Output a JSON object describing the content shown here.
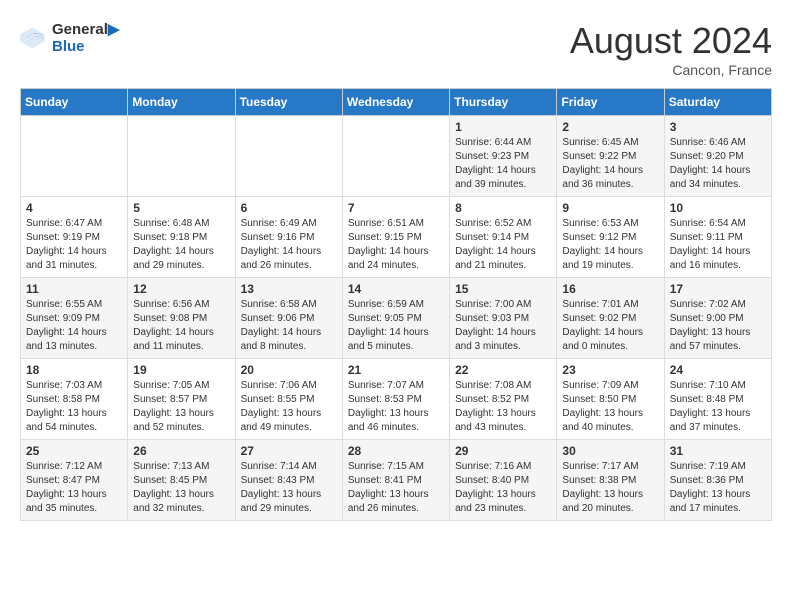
{
  "logo": {
    "line1": "General",
    "line2": "Blue"
  },
  "title": "August 2024",
  "location": "Cancon, France",
  "days_of_week": [
    "Sunday",
    "Monday",
    "Tuesday",
    "Wednesday",
    "Thursday",
    "Friday",
    "Saturday"
  ],
  "weeks": [
    [
      {
        "day": "",
        "info": ""
      },
      {
        "day": "",
        "info": ""
      },
      {
        "day": "",
        "info": ""
      },
      {
        "day": "",
        "info": ""
      },
      {
        "day": "1",
        "info": "Sunrise: 6:44 AM\nSunset: 9:23 PM\nDaylight: 14 hours\nand 39 minutes."
      },
      {
        "day": "2",
        "info": "Sunrise: 6:45 AM\nSunset: 9:22 PM\nDaylight: 14 hours\nand 36 minutes."
      },
      {
        "day": "3",
        "info": "Sunrise: 6:46 AM\nSunset: 9:20 PM\nDaylight: 14 hours\nand 34 minutes."
      }
    ],
    [
      {
        "day": "4",
        "info": "Sunrise: 6:47 AM\nSunset: 9:19 PM\nDaylight: 14 hours\nand 31 minutes."
      },
      {
        "day": "5",
        "info": "Sunrise: 6:48 AM\nSunset: 9:18 PM\nDaylight: 14 hours\nand 29 minutes."
      },
      {
        "day": "6",
        "info": "Sunrise: 6:49 AM\nSunset: 9:16 PM\nDaylight: 14 hours\nand 26 minutes."
      },
      {
        "day": "7",
        "info": "Sunrise: 6:51 AM\nSunset: 9:15 PM\nDaylight: 14 hours\nand 24 minutes."
      },
      {
        "day": "8",
        "info": "Sunrise: 6:52 AM\nSunset: 9:14 PM\nDaylight: 14 hours\nand 21 minutes."
      },
      {
        "day": "9",
        "info": "Sunrise: 6:53 AM\nSunset: 9:12 PM\nDaylight: 14 hours\nand 19 minutes."
      },
      {
        "day": "10",
        "info": "Sunrise: 6:54 AM\nSunset: 9:11 PM\nDaylight: 14 hours\nand 16 minutes."
      }
    ],
    [
      {
        "day": "11",
        "info": "Sunrise: 6:55 AM\nSunset: 9:09 PM\nDaylight: 14 hours\nand 13 minutes."
      },
      {
        "day": "12",
        "info": "Sunrise: 6:56 AM\nSunset: 9:08 PM\nDaylight: 14 hours\nand 11 minutes."
      },
      {
        "day": "13",
        "info": "Sunrise: 6:58 AM\nSunset: 9:06 PM\nDaylight: 14 hours\nand 8 minutes."
      },
      {
        "day": "14",
        "info": "Sunrise: 6:59 AM\nSunset: 9:05 PM\nDaylight: 14 hours\nand 5 minutes."
      },
      {
        "day": "15",
        "info": "Sunrise: 7:00 AM\nSunset: 9:03 PM\nDaylight: 14 hours\nand 3 minutes."
      },
      {
        "day": "16",
        "info": "Sunrise: 7:01 AM\nSunset: 9:02 PM\nDaylight: 14 hours\nand 0 minutes."
      },
      {
        "day": "17",
        "info": "Sunrise: 7:02 AM\nSunset: 9:00 PM\nDaylight: 13 hours\nand 57 minutes."
      }
    ],
    [
      {
        "day": "18",
        "info": "Sunrise: 7:03 AM\nSunset: 8:58 PM\nDaylight: 13 hours\nand 54 minutes."
      },
      {
        "day": "19",
        "info": "Sunrise: 7:05 AM\nSunset: 8:57 PM\nDaylight: 13 hours\nand 52 minutes."
      },
      {
        "day": "20",
        "info": "Sunrise: 7:06 AM\nSunset: 8:55 PM\nDaylight: 13 hours\nand 49 minutes."
      },
      {
        "day": "21",
        "info": "Sunrise: 7:07 AM\nSunset: 8:53 PM\nDaylight: 13 hours\nand 46 minutes."
      },
      {
        "day": "22",
        "info": "Sunrise: 7:08 AM\nSunset: 8:52 PM\nDaylight: 13 hours\nand 43 minutes."
      },
      {
        "day": "23",
        "info": "Sunrise: 7:09 AM\nSunset: 8:50 PM\nDaylight: 13 hours\nand 40 minutes."
      },
      {
        "day": "24",
        "info": "Sunrise: 7:10 AM\nSunset: 8:48 PM\nDaylight: 13 hours\nand 37 minutes."
      }
    ],
    [
      {
        "day": "25",
        "info": "Sunrise: 7:12 AM\nSunset: 8:47 PM\nDaylight: 13 hours\nand 35 minutes."
      },
      {
        "day": "26",
        "info": "Sunrise: 7:13 AM\nSunset: 8:45 PM\nDaylight: 13 hours\nand 32 minutes."
      },
      {
        "day": "27",
        "info": "Sunrise: 7:14 AM\nSunset: 8:43 PM\nDaylight: 13 hours\nand 29 minutes."
      },
      {
        "day": "28",
        "info": "Sunrise: 7:15 AM\nSunset: 8:41 PM\nDaylight: 13 hours\nand 26 minutes."
      },
      {
        "day": "29",
        "info": "Sunrise: 7:16 AM\nSunset: 8:40 PM\nDaylight: 13 hours\nand 23 minutes."
      },
      {
        "day": "30",
        "info": "Sunrise: 7:17 AM\nSunset: 8:38 PM\nDaylight: 13 hours\nand 20 minutes."
      },
      {
        "day": "31",
        "info": "Sunrise: 7:19 AM\nSunset: 8:36 PM\nDaylight: 13 hours\nand 17 minutes."
      }
    ]
  ]
}
